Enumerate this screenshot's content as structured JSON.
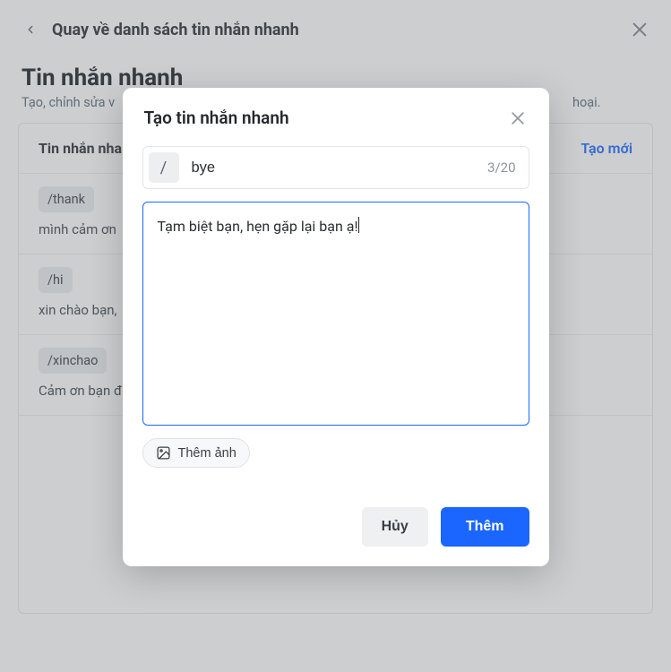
{
  "header": {
    "back_label": "Quay về danh sách tin nhắn nhanh"
  },
  "page": {
    "title": "Tin nhắn nhanh",
    "subtitle_prefix": "Tạo, chỉnh sửa v",
    "subtitle_suffix": "hoại."
  },
  "panel": {
    "title": "Tin nhắn nha",
    "create_label": "Tạo mới",
    "items": [
      {
        "tag": "/thank",
        "text": "mình cảm ơn "
      },
      {
        "tag": "/hi",
        "text": "xin chào bạn, "
      },
      {
        "tag": "/xinchao",
        "text": "Cảm ơn bạn đ"
      }
    ]
  },
  "modal": {
    "title": "Tạo tin nhắn nhanh",
    "slash": "/",
    "shortcut_value": "bye",
    "counter": "3/20",
    "message_value": "Tạm biệt bạn, hẹn gặp lại bạn ạ!",
    "add_image_label": "Thêm ảnh",
    "cancel_label": "Hủy",
    "submit_label": "Thêm"
  }
}
